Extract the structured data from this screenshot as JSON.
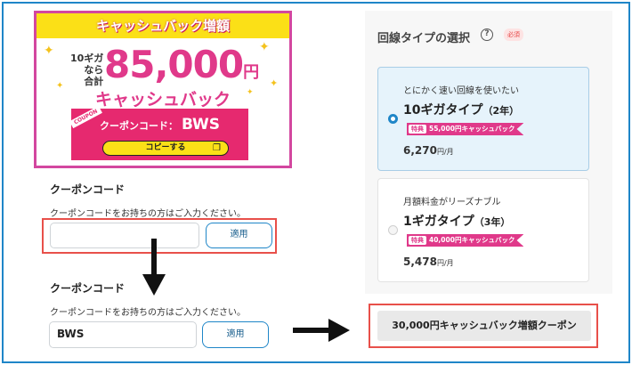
{
  "banner": {
    "header": "キャッシュバック増額",
    "condition_line1": "10ギガ",
    "condition_line2": "なら",
    "condition_line3": "合計",
    "amount": "85,000",
    "amount_unit": "円",
    "subtitle": "キャッシュバック",
    "coupon_tag": "COUPON",
    "coupon_label": "クーポンコード：",
    "coupon_code": "BWS",
    "copy_button": "コピーする"
  },
  "coupon_form_before": {
    "title": "クーポンコード",
    "description": "クーポンコードをお持ちの方はご入力ください。",
    "input_value": "",
    "apply_button": "適用"
  },
  "coupon_form_after": {
    "title": "クーポンコード",
    "description": "クーポンコードをお持ちの方はご入力ください。",
    "input_value": "BWS",
    "apply_button": "適用"
  },
  "line_type": {
    "title": "回線タイプの選択",
    "required_badge": "必須",
    "plans": [
      {
        "lead": "とにかく速い回線を使いたい",
        "name": "10ギガタイプ",
        "term": "（2年）",
        "promo_tag": "特典",
        "promo_text": "55,000円キャッシュバック",
        "price": "6,270",
        "price_unit": "円/月",
        "selected": true
      },
      {
        "lead": "月額料金がリーズナブル",
        "name": "1ギガタイプ",
        "term": "（3年）",
        "promo_tag": "特典",
        "promo_text": "40,000円キャッシュバック",
        "price": "5,478",
        "price_unit": "円/月",
        "selected": false
      }
    ]
  },
  "result": {
    "label": "30,000円キャッシュバック増額クーポン"
  },
  "colors": {
    "accent_pink": "#e0398a",
    "banner_yellow": "#fbe017",
    "primary_blue": "#1f86c8",
    "highlight_red": "#e8504a"
  }
}
